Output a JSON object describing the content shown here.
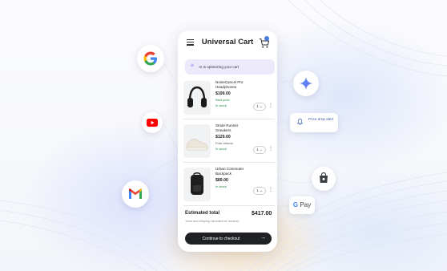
{
  "app": {
    "title": "Universal Cart",
    "ai_banner": "AI is optimizing your cart"
  },
  "items": [
    {
      "name": "NoiseCancel Pro Headphones",
      "price": "$199.00",
      "note": "Best price",
      "stock": "In stock",
      "qty": "1",
      "icon": "headphones"
    },
    {
      "name": "Stride Runner Sneakers",
      "price": "$129.00",
      "note": "Free returns",
      "stock": "In stock",
      "qty": "1",
      "icon": "sneaker"
    },
    {
      "name": "Urban Commuter Backpack",
      "price": "$89.00",
      "note": "",
      "stock": "In stock",
      "qty": "1",
      "icon": "backpack"
    }
  ],
  "summary": {
    "total_label": "Estimated total",
    "total_value": "$417.00",
    "note": "Taxes and shipping calculated at checkout",
    "checkout_label": "Continue to checkout"
  },
  "side": {
    "price_drop_alert": "Price drop alert",
    "gpay_label": "Pay",
    "gpay_g": "G"
  },
  "colors": {
    "accent": "#4c7bdc",
    "stock_green": "#2e8a44",
    "checkout_bg": "#1f2125",
    "banner_bg": "#ece9fb"
  }
}
